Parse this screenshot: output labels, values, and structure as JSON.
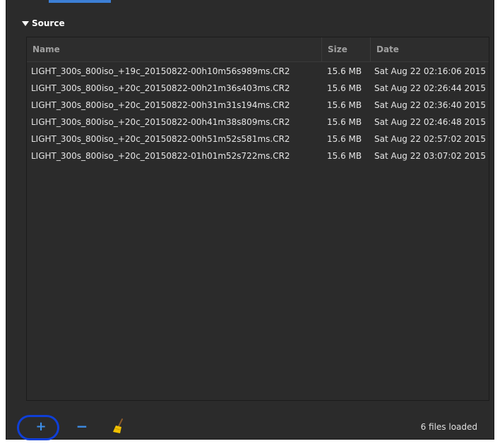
{
  "section": {
    "title": "Source"
  },
  "table": {
    "headers": {
      "name": "Name",
      "size": "Size",
      "date": "Date"
    },
    "rows": [
      {
        "name": "LIGHT_300s_800iso_+19c_20150822-00h10m56s989ms.CR2",
        "size": "15.6  MB",
        "date": "Sat Aug 22 02:16:06 2015"
      },
      {
        "name": "LIGHT_300s_800iso_+20c_20150822-00h21m36s403ms.CR2",
        "size": "15.6  MB",
        "date": "Sat Aug 22 02:26:44 2015"
      },
      {
        "name": "LIGHT_300s_800iso_+20c_20150822-00h31m31s194ms.CR2",
        "size": "15.6  MB",
        "date": "Sat Aug 22 02:36:40 2015"
      },
      {
        "name": "LIGHT_300s_800iso_+20c_20150822-00h41m38s809ms.CR2",
        "size": "15.6  MB",
        "date": "Sat Aug 22 02:46:48 2015"
      },
      {
        "name": "LIGHT_300s_800iso_+20c_20150822-00h51m52s581ms.CR2",
        "size": "15.6  MB",
        "date": "Sat Aug 22 02:57:02 2015"
      },
      {
        "name": "LIGHT_300s_800iso_+20c_20150822-01h01m52s722ms.CR2",
        "size": "15.6  MB",
        "date": "Sat Aug 22 03:07:02 2015"
      }
    ]
  },
  "toolbar": {
    "add_symbol": "+",
    "remove_symbol": "−",
    "icons": {
      "add": "plus-icon",
      "remove": "minus-icon",
      "clear": "broom-icon"
    }
  },
  "status": {
    "text": "6 files loaded"
  },
  "colors": {
    "panel_background": "#2b2b2b",
    "accent_blue": "#3d8ee8",
    "highlight_ring": "#0f3fd8"
  }
}
